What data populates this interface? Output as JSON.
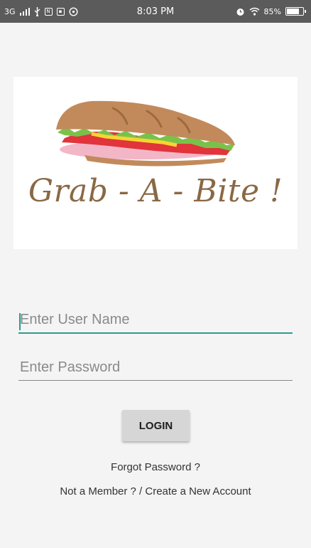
{
  "status_bar": {
    "network": "3G",
    "time": "8:03 PM",
    "battery": "85%",
    "battery_level": 0.85,
    "icons": [
      "signal-icon",
      "usb-icon",
      "notification-icon",
      "image-icon",
      "whatsapp-icon",
      "alarm-icon",
      "wifi-icon",
      "battery-icon"
    ]
  },
  "logo": {
    "title": "Grab - A - Bite !",
    "image": "sandwich-icon"
  },
  "form": {
    "username_placeholder": "Enter User Name",
    "password_placeholder": "Enter Password",
    "login_label": "LOGIN"
  },
  "links": {
    "forgot_password": "Forgot Password ?",
    "sign_up": "Not a Member ? / Create a New Account"
  },
  "colors": {
    "accent": "#2a9d8f",
    "title_brown": "#8a6845",
    "status_bar": "#5b5b5b",
    "background": "#f4f4f4"
  }
}
